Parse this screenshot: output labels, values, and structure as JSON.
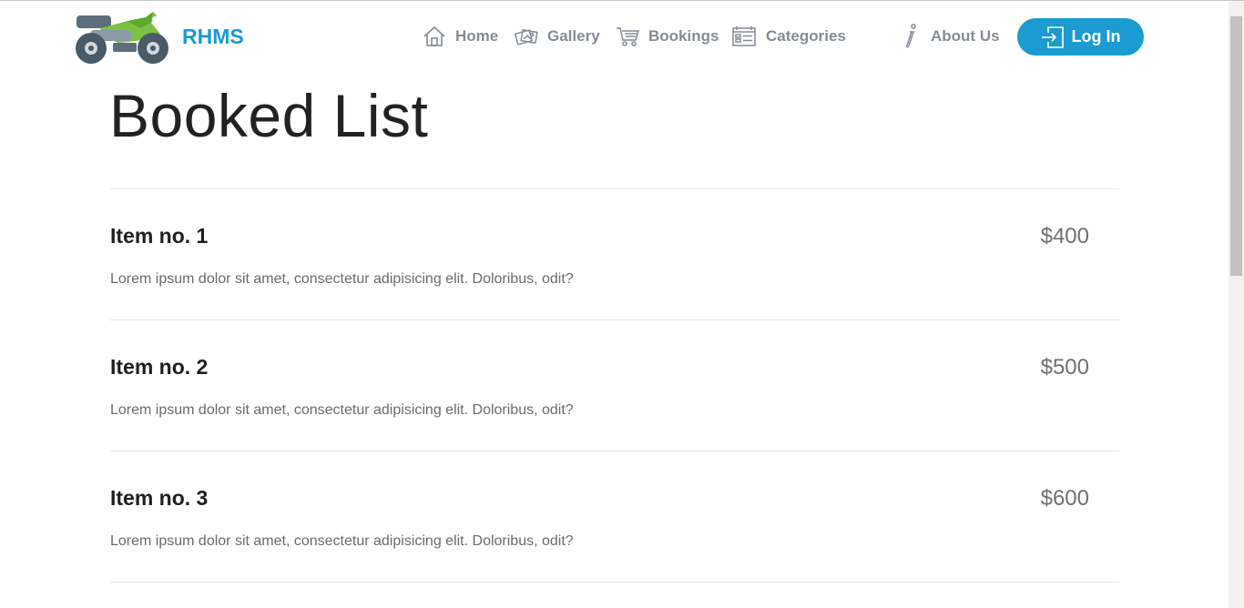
{
  "brand": {
    "name": "RHMS",
    "logo_icon": "motorcycle-icon"
  },
  "nav": {
    "home": {
      "label": "Home",
      "icon": "home-icon"
    },
    "gallery": {
      "label": "Gallery",
      "icon": "photos-icon"
    },
    "bookings": {
      "label": "Bookings",
      "icon": "cart-icon"
    },
    "categories": {
      "label": "Categories",
      "icon": "list-icon"
    },
    "about": {
      "label": "About Us",
      "icon": "info-icon"
    },
    "login": {
      "label": "Log In",
      "icon": "login-icon"
    }
  },
  "page": {
    "title": "Booked List"
  },
  "items": [
    {
      "title": "Item no. 1",
      "price": "$400",
      "description": "Lorem ipsum dolor sit amet, consectetur adipisicing elit. Doloribus, odit?"
    },
    {
      "title": "Item no. 2",
      "price": "$500",
      "description": "Lorem ipsum dolor sit amet, consectetur adipisicing elit. Doloribus, odit?"
    },
    {
      "title": "Item no. 3",
      "price": "$600",
      "description": "Lorem ipsum dolor sit amet, consectetur adipisicing elit. Doloribus, odit?"
    }
  ],
  "colors": {
    "accent": "#1a9bd1",
    "nav_text": "#848c95",
    "logo_green": "#7cc242",
    "logo_gray": "#5d6d7a"
  }
}
